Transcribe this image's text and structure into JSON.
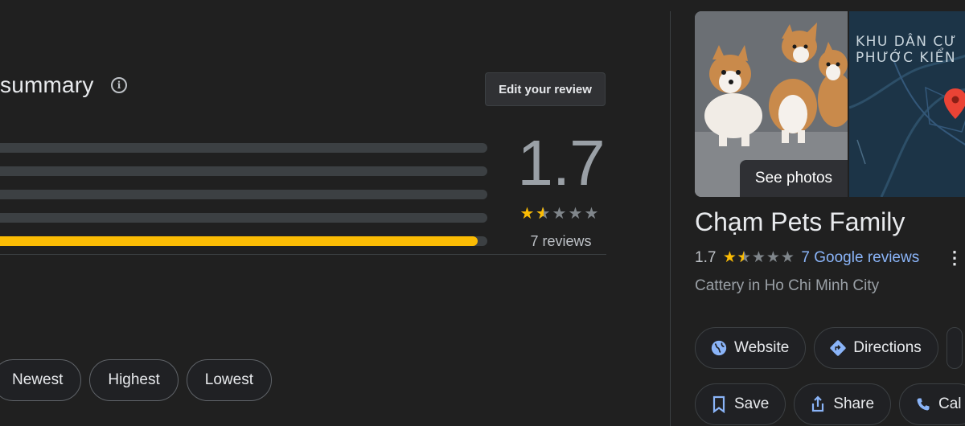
{
  "summary": {
    "title": "summary",
    "edit_review_label": "Edit your review",
    "rating": "1.7",
    "reviews_count": "7 reviews",
    "rating_value": 1.7,
    "distribution_fill": [
      0,
      0,
      0,
      0,
      0.98
    ]
  },
  "sort": {
    "chips": [
      "Newest",
      "Highest",
      "Lowest"
    ]
  },
  "place": {
    "see_photos_label": "See photos",
    "map_labels": [
      "KHU DÂN CƯ",
      "PHƯỚC KIỂN"
    ],
    "title": "Chạm Pets Family",
    "rating": "1.7",
    "reviews_link": "7 Google reviews",
    "category": "Cattery in Ho Chi Minh City",
    "actions_row1": [
      "Website",
      "Directions"
    ],
    "actions_row2": [
      "Save",
      "Share",
      "Cal"
    ]
  },
  "colors": {
    "accent_star": "#fbbc04",
    "link": "#8ab4f8",
    "action_icon": "#8ab4f8"
  }
}
